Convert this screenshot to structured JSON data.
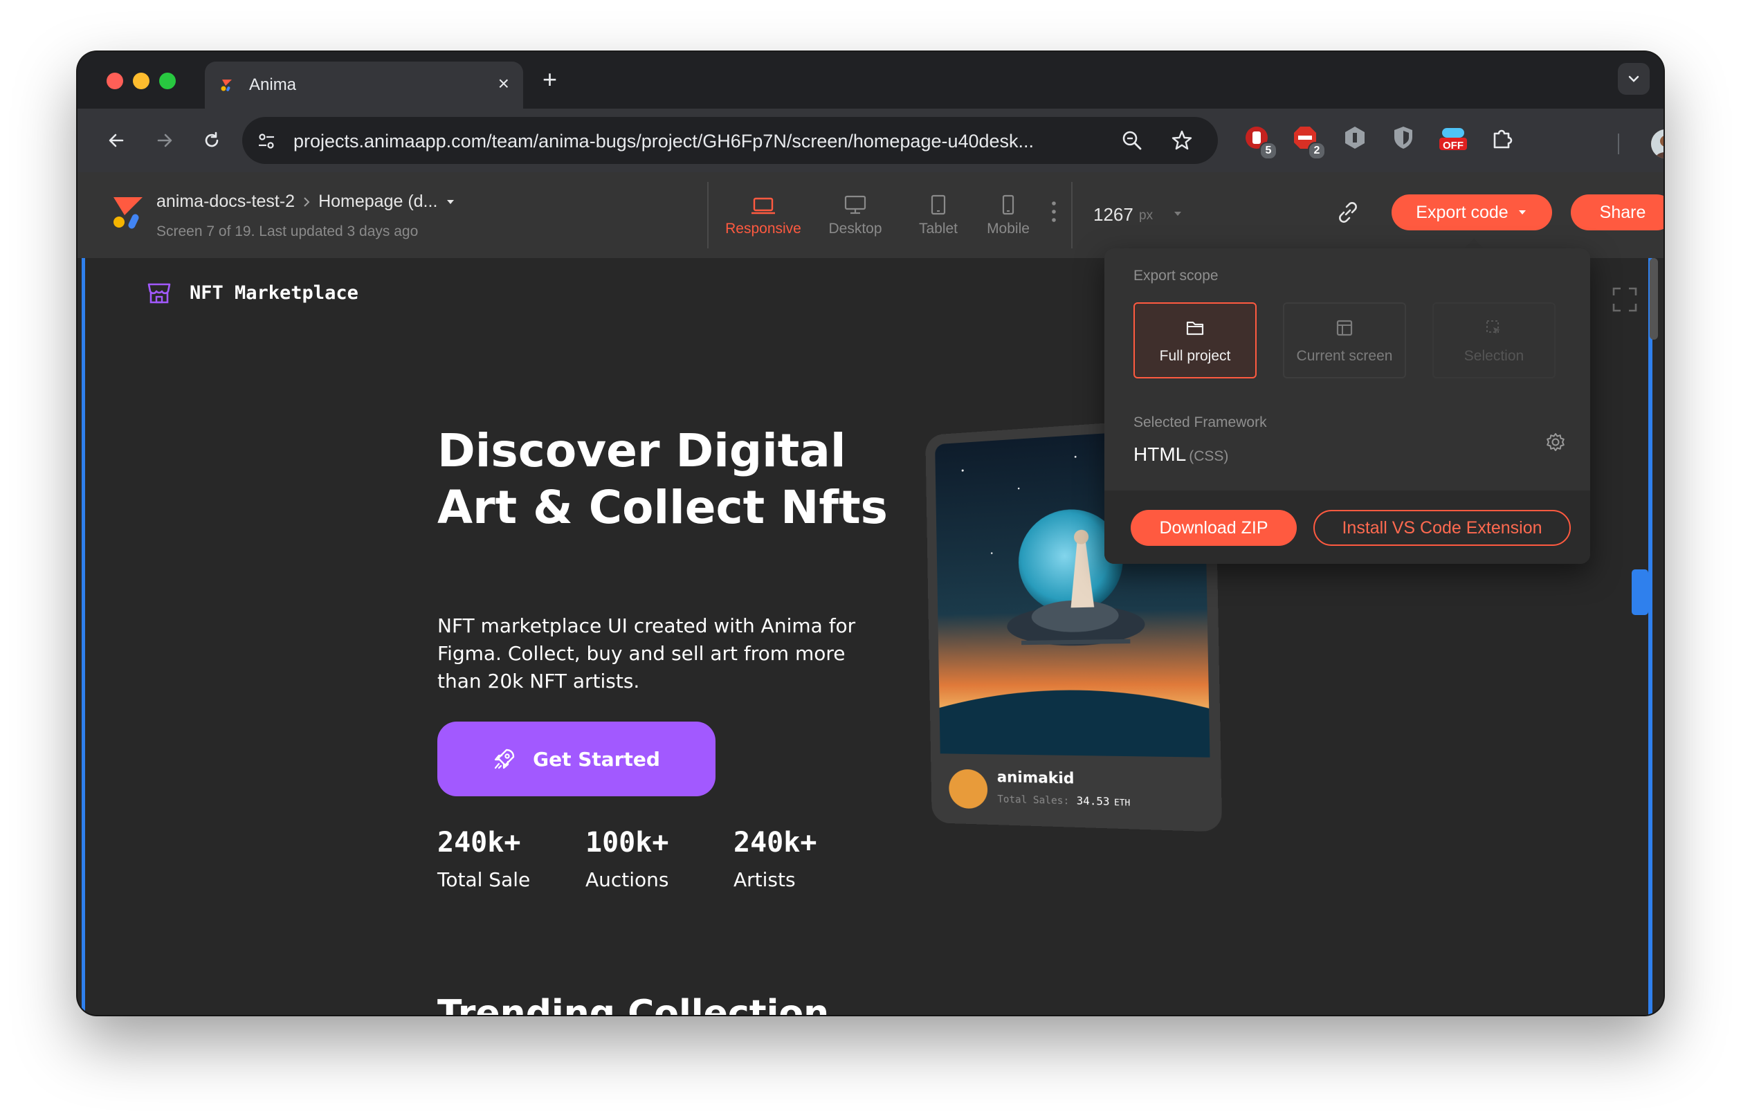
{
  "browser": {
    "tab_title": "Anima",
    "url": "projects.animaapp.com/team/anima-bugs/project/GH6Fp7N/screen/homepage-u40desk...",
    "extensions": [
      {
        "name": "ublock-icon",
        "badge": "5",
        "color": "#e02020"
      },
      {
        "name": "abp-icon",
        "badge": "2",
        "color": "#e02020"
      },
      {
        "name": "ext-hex-icon",
        "badge": "",
        "color": "#9aa0a6"
      },
      {
        "name": "shield-icon",
        "badge": "",
        "color": "#9aa0a6"
      },
      {
        "name": "off-toggle-icon",
        "badge": "OFF",
        "color": "#e02020"
      },
      {
        "name": "puzzle-icon",
        "badge": "",
        "color": "#e8eaed"
      }
    ]
  },
  "anima": {
    "project_name": "anima-docs-test-2",
    "screen_name": "Homepage (d...",
    "screen_meta": "Screen 7 of 19. Last updated 3 days ago",
    "devices": [
      {
        "label": "Responsive",
        "active": true
      },
      {
        "label": "Desktop",
        "active": false
      },
      {
        "label": "Tablet",
        "active": false
      },
      {
        "label": "Mobile",
        "active": false
      }
    ],
    "width_value": "1267",
    "width_unit": "px",
    "export_label": "Export code",
    "share_label": "Share",
    "accent_color": "#ff5a40"
  },
  "export_popover": {
    "scope_label": "Export scope",
    "scopes": [
      {
        "label": "Full project",
        "state": "active"
      },
      {
        "label": "Current screen",
        "state": "enabled"
      },
      {
        "label": "Selection",
        "state": "disabled"
      }
    ],
    "framework_label": "Selected Framework",
    "framework_name": "HTML",
    "framework_variant": "(CSS)",
    "download_label": "Download ZIP",
    "vscode_label": "Install VS Code Extension"
  },
  "site": {
    "brand": "NFT Marketplace",
    "hero_title": "Discover Digital Art & Collect Nfts",
    "hero_description": "NFT marketplace UI created with Anima for Figma. Collect, buy and sell art from more than 20k NFT artists.",
    "cta_label": "Get Started",
    "cta_color": "#a259ff",
    "stats": [
      {
        "value": "240k+",
        "label": "Total Sale"
      },
      {
        "value": "100k+",
        "label": "Auctions"
      },
      {
        "value": "240k+",
        "label": "Artists"
      }
    ],
    "nft_card": {
      "artist": "animakid",
      "sales_label": "Total Sales:",
      "sales_value": "34.53",
      "currency": "ETH"
    },
    "section_title": "Trending Collection"
  }
}
